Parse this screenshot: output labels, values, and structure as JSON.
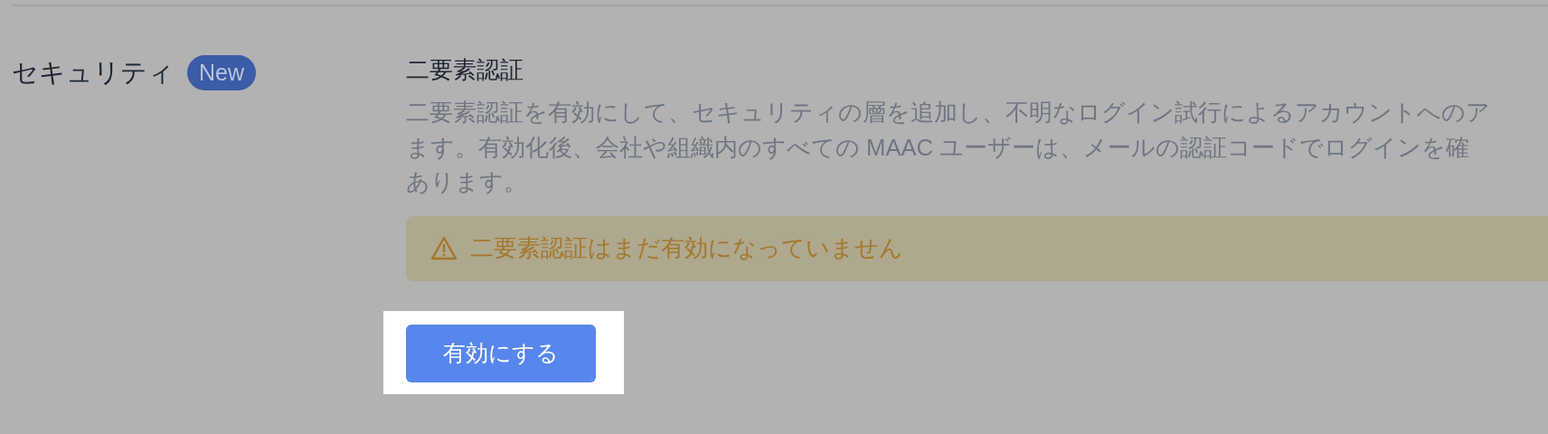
{
  "section": {
    "label": "セキュリティ",
    "badge": "New"
  },
  "setting": {
    "title": "二要素認証",
    "description_lines": [
      "二要素認証を有効にして、セキュリティの層を追加し、不明なログイン試行によるアカウントへのア",
      "ます。有効化後、会社や組織内のすべての MAAC ユーザーは、メールの認証コードでログインを確",
      "あります。"
    ],
    "warning": {
      "text": "二要素認証はまだ有効になっていません"
    },
    "button": {
      "label": "有効にする",
      "highlighted": true
    }
  }
}
